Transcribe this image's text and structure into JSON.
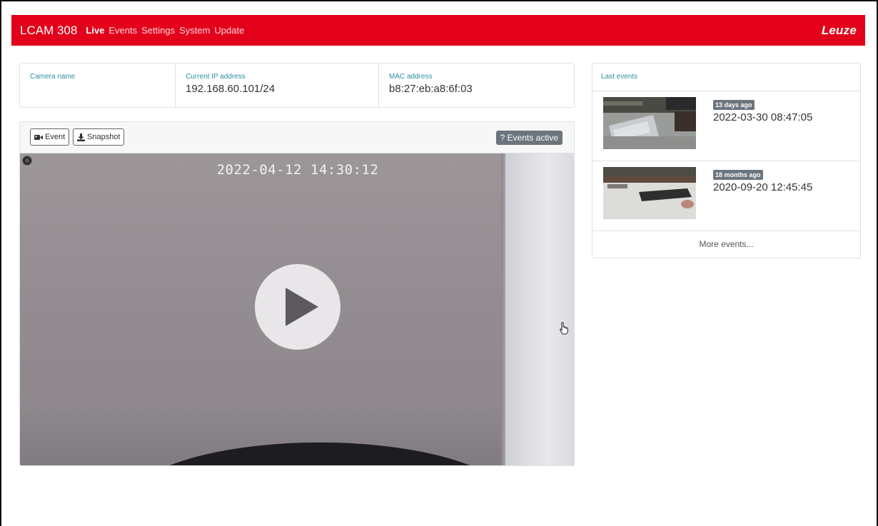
{
  "nav": {
    "brand": "LCAM 308",
    "links": [
      {
        "label": "Live",
        "active": true
      },
      {
        "label": "Events",
        "active": false
      },
      {
        "label": "Settings",
        "active": false
      },
      {
        "label": "System",
        "active": false
      },
      {
        "label": "Update",
        "active": false
      }
    ],
    "logo": "Leuze",
    "color": "#e2001a"
  },
  "info": {
    "camera_name_label": "Camera name",
    "camera_name_value": "",
    "ip_label": "Current IP address",
    "ip_value": "192.168.60.101/24",
    "mac_label": "MAC address",
    "mac_value": "b8:27:eb:a8:6f:03"
  },
  "video": {
    "event_button": "Event",
    "snapshot_button": "Snapshot",
    "status_badge": "? Events active",
    "timestamp": "2022-04-12 14:30:12"
  },
  "events": {
    "header": "Last events",
    "items": [
      {
        "age": "13 days ago",
        "time": "2022-03-30 08:47:05"
      },
      {
        "age": "18 months ago",
        "time": "2020-09-20 12:45:45"
      }
    ],
    "more": "More events..."
  },
  "colors": {
    "accent_label": "#2b8fa3",
    "badge": "#6c757d"
  }
}
